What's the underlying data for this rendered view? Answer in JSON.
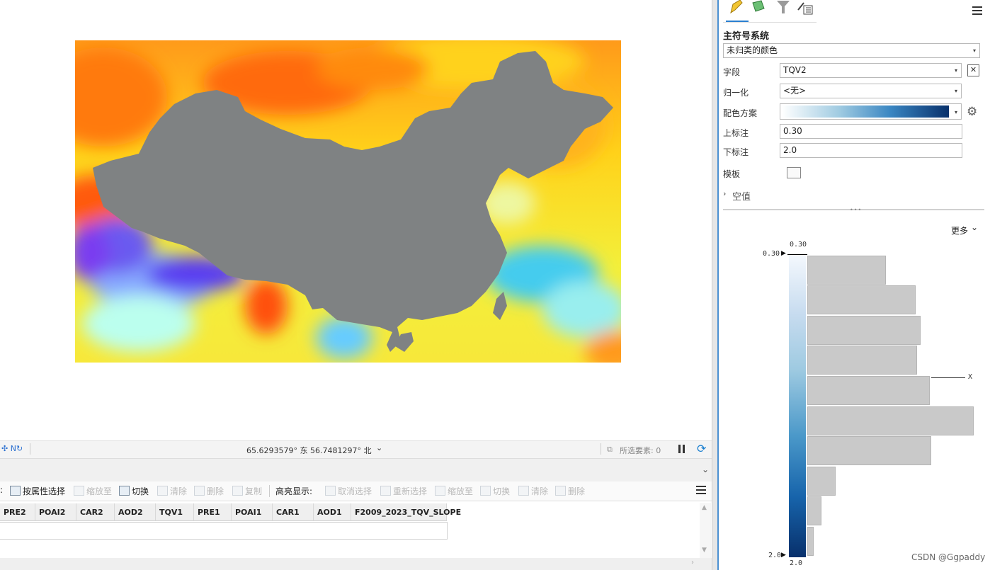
{
  "status": {
    "coordinates": "65.6293579° 东 56.7481297° 北",
    "selected_features": "所选要素: 0"
  },
  "toolbar": {
    "select_by_attr": "按属性选择",
    "zoom_to": "缩放至",
    "switch": "切换",
    "clear": "清除",
    "delete": "删除",
    "copy": "复制",
    "highlight_label": "高亮显示:",
    "unselect": "取消选择",
    "reselect": "重新选择",
    "hl_zoom_to": "缩放至",
    "hl_switch": "切换",
    "hl_clear": "清除",
    "hl_delete": "删除"
  },
  "table": {
    "columns": [
      "PRE2",
      "POAI2",
      "CAR2",
      "AOD2",
      "TQV1",
      "PRE1",
      "POAI1",
      "CAR1",
      "AOD1",
      "F2009_2023_TQV_SLOPE"
    ]
  },
  "symbology": {
    "primary_title": "主符号系统",
    "primary_value": "未归类的颜色",
    "field_label": "字段",
    "field_value": "TQV2",
    "normalize_label": "归一化",
    "normalize_value": "<无>",
    "color_scheme_label": "配色方案",
    "upper_label_text": "上标注",
    "upper_value": "0.30",
    "lower_label_text": "下标注",
    "lower_value": "2.0",
    "template_label": "模板",
    "null_label": "空值",
    "more_label": "更多",
    "color_ramp": [
      "#f4f8fd",
      "#08306b"
    ]
  },
  "histogram": {
    "top_value": "0.30",
    "top_marker": "0.30",
    "bottom_value": "2.0",
    "bottom_marker": "2.0",
    "x_label": "X",
    "bins": [
      0.51,
      0.7,
      0.74,
      0.71,
      0.79,
      1.0,
      0.8,
      0.17,
      0.08,
      0.03
    ]
  },
  "watermark": "CSDN @Ggpaddy"
}
